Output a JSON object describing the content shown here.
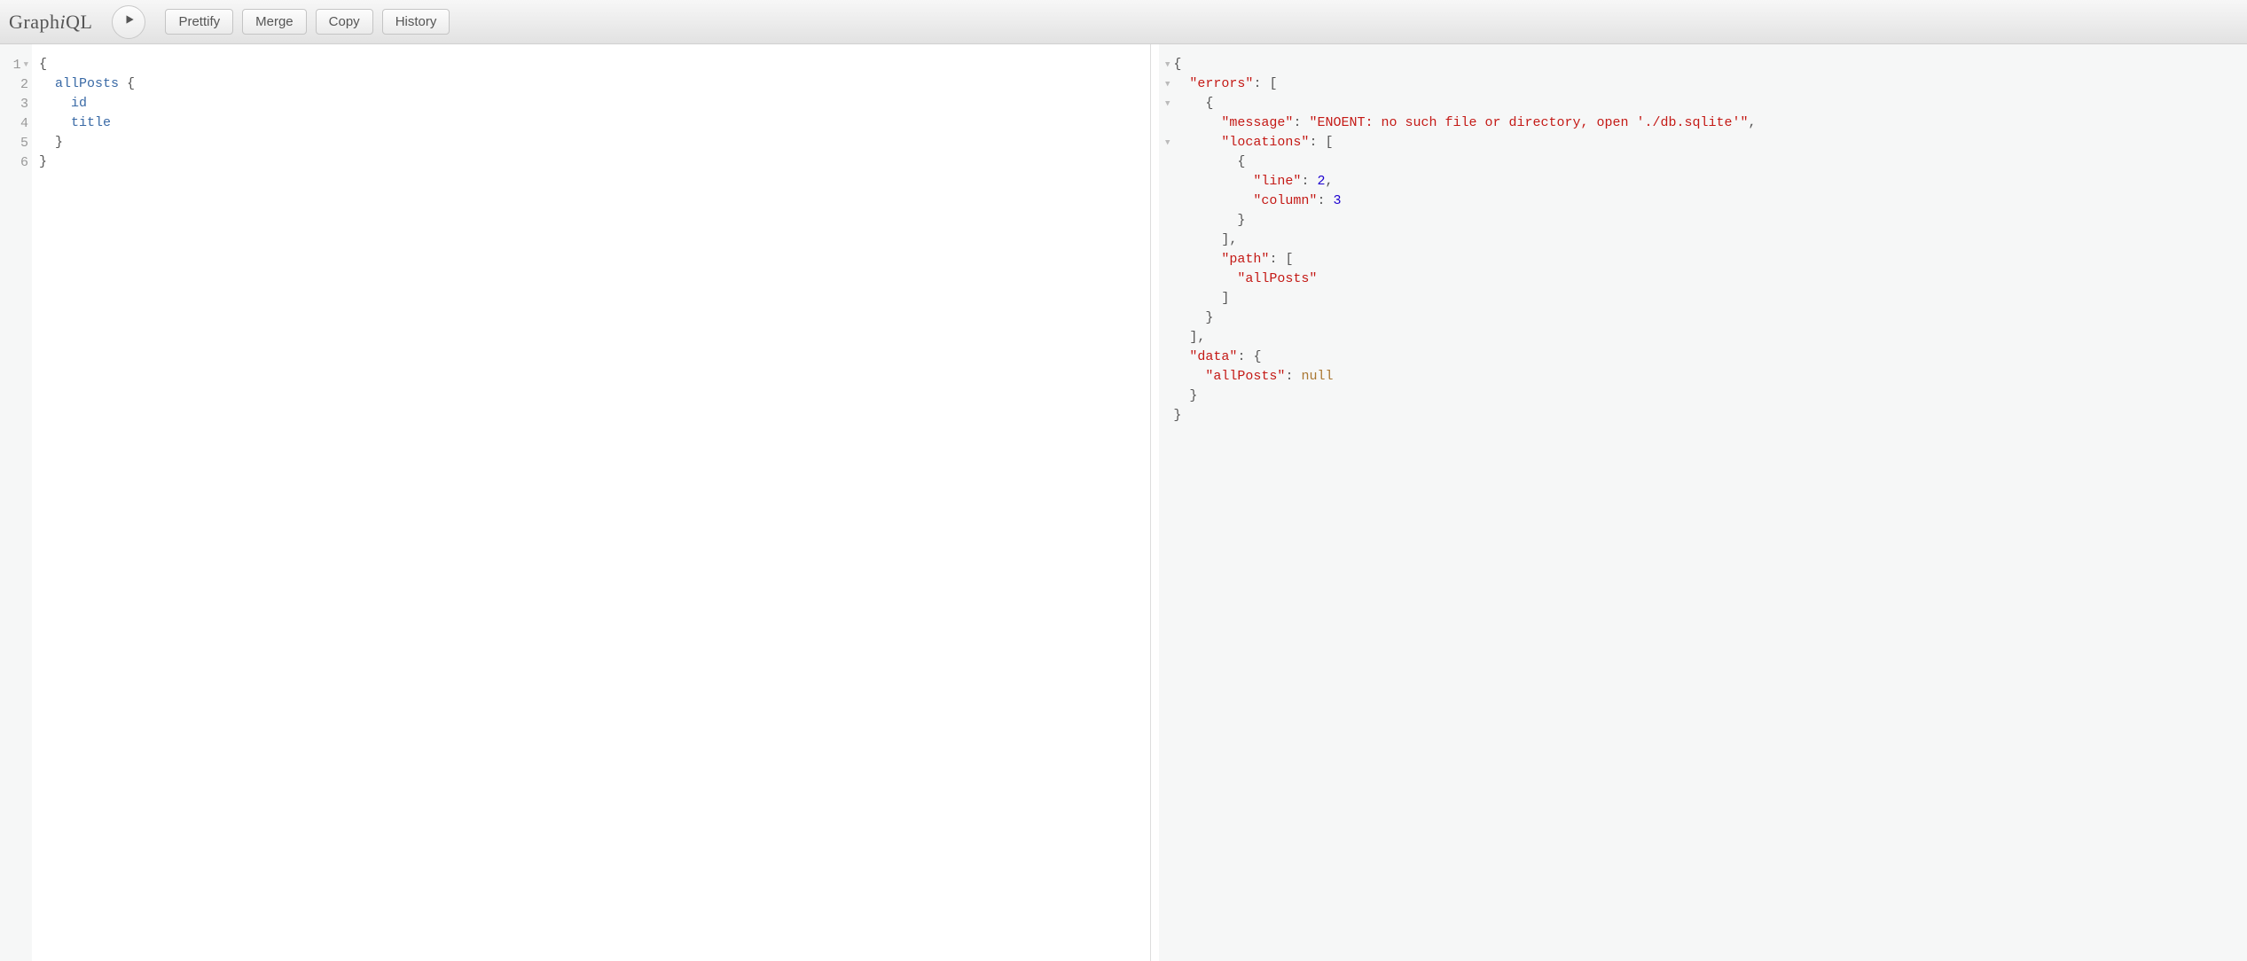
{
  "app": {
    "title_prefix": "Graph",
    "title_italic": "i",
    "title_suffix": "QL"
  },
  "toolbar": {
    "prettify": "Prettify",
    "merge": "Merge",
    "copy": "Copy",
    "history": "History"
  },
  "query": {
    "line_numbers": [
      "1",
      "2",
      "3",
      "4",
      "5",
      "6"
    ],
    "lines": [
      {
        "indent": 0,
        "tokens": [
          {
            "t": "{",
            "cls": "brace"
          }
        ]
      },
      {
        "indent": 1,
        "tokens": [
          {
            "t": "allPosts",
            "cls": "kw"
          },
          {
            "t": " {",
            "cls": "brace"
          }
        ]
      },
      {
        "indent": 2,
        "tokens": [
          {
            "t": "id",
            "cls": "kw"
          }
        ]
      },
      {
        "indent": 2,
        "tokens": [
          {
            "t": "title",
            "cls": "kw"
          }
        ]
      },
      {
        "indent": 1,
        "tokens": [
          {
            "t": "}",
            "cls": "brace"
          }
        ]
      },
      {
        "indent": 0,
        "tokens": [
          {
            "t": "}",
            "cls": "brace"
          }
        ]
      }
    ],
    "fold_rows": [
      1
    ]
  },
  "result": {
    "fold_rows": [
      1,
      2,
      3,
      5
    ],
    "lines": [
      {
        "indent": 0,
        "tokens": [
          {
            "t": "{",
            "cls": "punc"
          }
        ]
      },
      {
        "indent": 1,
        "tokens": [
          {
            "t": "\"errors\"",
            "cls": "key"
          },
          {
            "t": ": [",
            "cls": "punc"
          }
        ]
      },
      {
        "indent": 2,
        "tokens": [
          {
            "t": "{",
            "cls": "punc"
          }
        ]
      },
      {
        "indent": 3,
        "tokens": [
          {
            "t": "\"message\"",
            "cls": "key"
          },
          {
            "t": ": ",
            "cls": "punc"
          },
          {
            "t": "\"ENOENT: no such file or directory, open './db.sqlite'\"",
            "cls": "str"
          },
          {
            "t": ",",
            "cls": "punc"
          }
        ]
      },
      {
        "indent": 3,
        "tokens": [
          {
            "t": "\"locations\"",
            "cls": "key"
          },
          {
            "t": ": [",
            "cls": "punc"
          }
        ]
      },
      {
        "indent": 4,
        "tokens": [
          {
            "t": "{",
            "cls": "punc"
          }
        ]
      },
      {
        "indent": 5,
        "tokens": [
          {
            "t": "\"line\"",
            "cls": "key"
          },
          {
            "t": ": ",
            "cls": "punc"
          },
          {
            "t": "2",
            "cls": "num"
          },
          {
            "t": ",",
            "cls": "punc"
          }
        ]
      },
      {
        "indent": 5,
        "tokens": [
          {
            "t": "\"column\"",
            "cls": "key"
          },
          {
            "t": ": ",
            "cls": "punc"
          },
          {
            "t": "3",
            "cls": "num"
          }
        ]
      },
      {
        "indent": 4,
        "tokens": [
          {
            "t": "}",
            "cls": "punc"
          }
        ]
      },
      {
        "indent": 3,
        "tokens": [
          {
            "t": "],",
            "cls": "punc"
          }
        ]
      },
      {
        "indent": 3,
        "tokens": [
          {
            "t": "\"path\"",
            "cls": "key"
          },
          {
            "t": ": [",
            "cls": "punc"
          }
        ]
      },
      {
        "indent": 4,
        "tokens": [
          {
            "t": "\"allPosts\"",
            "cls": "str"
          }
        ]
      },
      {
        "indent": 3,
        "tokens": [
          {
            "t": "]",
            "cls": "punc"
          }
        ]
      },
      {
        "indent": 2,
        "tokens": [
          {
            "t": "}",
            "cls": "punc"
          }
        ]
      },
      {
        "indent": 1,
        "tokens": [
          {
            "t": "],",
            "cls": "punc"
          }
        ]
      },
      {
        "indent": 1,
        "tokens": [
          {
            "t": "\"data\"",
            "cls": "key"
          },
          {
            "t": ": {",
            "cls": "punc"
          }
        ]
      },
      {
        "indent": 2,
        "tokens": [
          {
            "t": "\"allPosts\"",
            "cls": "key"
          },
          {
            "t": ": ",
            "cls": "punc"
          },
          {
            "t": "null",
            "cls": "null"
          }
        ]
      },
      {
        "indent": 1,
        "tokens": [
          {
            "t": "}",
            "cls": "punc"
          }
        ]
      },
      {
        "indent": 0,
        "tokens": [
          {
            "t": "}",
            "cls": "punc"
          }
        ]
      }
    ]
  }
}
